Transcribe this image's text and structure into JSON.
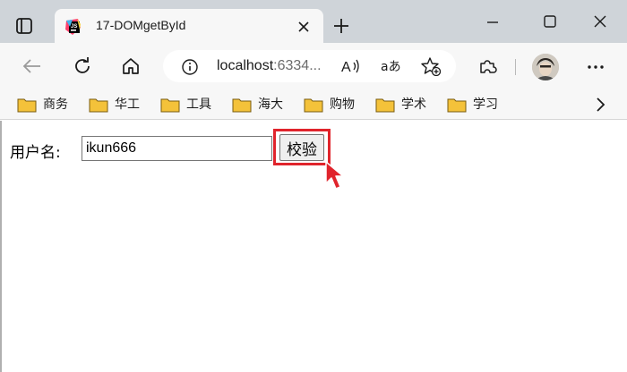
{
  "browser": {
    "tab_title": "17-DOMgetById",
    "address": {
      "host": "localhost",
      "port_truncated": ":6334..."
    }
  },
  "bookmarks": [
    {
      "label": "商务"
    },
    {
      "label": "华工"
    },
    {
      "label": "工具"
    },
    {
      "label": "海大"
    },
    {
      "label": "购物"
    },
    {
      "label": "学术"
    },
    {
      "label": "学习"
    }
  ],
  "page": {
    "username_label": "用户名:",
    "username_value": "ikun666",
    "check_button": "校验"
  },
  "colors": {
    "titlebar": "#cfd4d9",
    "toolbar": "#f7f7f7",
    "highlight": "#e0242c",
    "folder": "#f4c23a"
  },
  "icons": [
    "tab-actions-icon",
    "app-favicon-icon",
    "close-icon",
    "plus-icon",
    "minimize-icon",
    "maximize-icon",
    "back-arrow-icon",
    "reload-icon",
    "home-icon",
    "info-icon",
    "read-aloud-icon",
    "translate-icon",
    "favorites-star-icon",
    "extensions-icon",
    "more-icon",
    "folder-icon",
    "chevron-right-icon",
    "cursor-icon"
  ]
}
